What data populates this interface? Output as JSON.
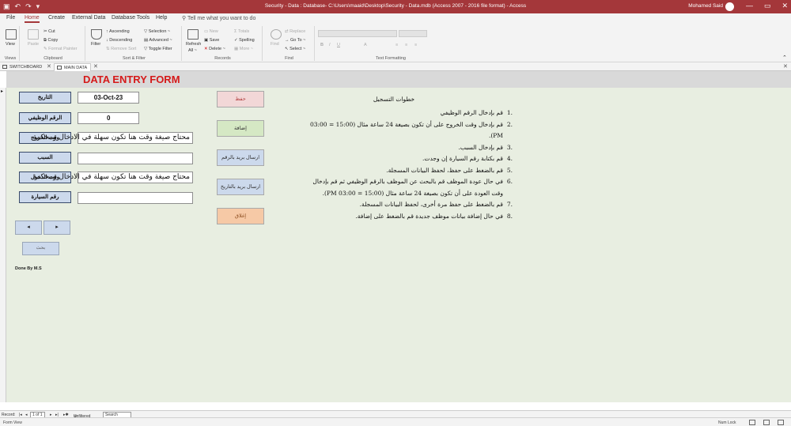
{
  "titlebar": {
    "title": "Security - Data : Database- C:\\Users\\maaid\\Desktop\\Security - Data.mdb (Access 2007 - 2016 file format) - Access",
    "user": "Mohamed Said",
    "minimize": "—",
    "restore": "▭",
    "close": "✕"
  },
  "menu": {
    "file": "File",
    "home": "Home",
    "create": "Create",
    "external": "External Data",
    "dbtools": "Database Tools",
    "help": "Help",
    "tellme": "Tell me what you want to do"
  },
  "ribbon": {
    "views": {
      "view": "View",
      "label": "Views"
    },
    "clipboard": {
      "paste": "Paste",
      "cut": "Cut",
      "copy": "Copy",
      "format_painter": "Format Painter",
      "label": "Clipboard"
    },
    "sortfilter": {
      "filter": "Filter",
      "ascending": "Ascending",
      "descending": "Descending",
      "remove_sort": "Remove Sort",
      "selection": "Selection ~",
      "advanced": "Advanced ~",
      "toggle_filter": "Toggle Filter",
      "label": "Sort & Filter"
    },
    "records": {
      "refresh": "Refresh",
      "all": "All ~",
      "new": "New",
      "save": "Save",
      "delete": "Delete ~",
      "totals": "Totals",
      "spelling": "Spelling",
      "more": "More ~",
      "label": "Records"
    },
    "find": {
      "find": "Find",
      "replace": "Replace",
      "goto": "Go To ~",
      "select": "Select ~",
      "label": "Find"
    },
    "text_formatting": {
      "label": "Text Formatting"
    }
  },
  "object_tabs": {
    "switchboard": "SWITCHBOARD",
    "main_data": "MAIN DATA"
  },
  "form": {
    "title": "DATA ENTRY FORM",
    "fields": {
      "date_label": "التاريخ",
      "date_value": "03-Oct-23",
      "id_label": "الرقم الوظيفي",
      "id_value": "0",
      "exit_label": "وقت الخروج",
      "exit_value": "محتاج صيغة وقت هنا تكون سهلة في الادخال ومحكمة",
      "reason_label": "السبب",
      "reason_value": "",
      "entry_label": "وقت الدخول",
      "entry_value": "محتاج صيغة وقت هنا تكون سهلة في الادخال ومحكمة",
      "car_label": "رقم السيارة",
      "car_value": ""
    },
    "buttons": {
      "save": "حفظ",
      "add": "إضافة",
      "mail_by_id": "ارسال بريد بالرقم",
      "mail_by_date": "ارسال بريد بالتاريخ",
      "close": "إغلاق",
      "prev": "◂",
      "next": "▸",
      "search": "بحث"
    },
    "done_by": "Done By M.S",
    "instructions": {
      "title": "خطوات التسجيل",
      "steps": [
        {
          "num": "1.",
          "text": "قم بإدخال الرقم الوظيفي"
        },
        {
          "num": "2.",
          "text": "قم بإدخال وقت الخروج على أن تكون بصيغة 24 ساعة مثال (15:00 = 03:00 PM)."
        },
        {
          "num": "3.",
          "text": "قم بإدخال السبب."
        },
        {
          "num": "4.",
          "text": "قم بكتابة رقم السيارة إن وجدت."
        },
        {
          "num": "5.",
          "text": "قم بالضغط على حفظ، لحفظ البيانات المسجلة."
        },
        {
          "num": "6.",
          "text": "في حال عودة الموظف قم بالبحث عن الموظف بالرقم الوظيفي ثم قم بإدخال وقت العودة على أن تكون بصيغة 24 ساعة مثال (15:00 = 03:00 PM)."
        },
        {
          "num": "7.",
          "text": "قم بالضغط على حفظ مرة أخرى، لحفظ البيانات المسجلة."
        },
        {
          "num": "8.",
          "text": "في حال إضافة بيانات موظف جديدة قم بالضغط على إضافة."
        }
      ]
    }
  },
  "record_nav": {
    "record_label": "Record:",
    "position": "1 of 1",
    "filter": "Unfiltered",
    "search": "Search"
  },
  "status": {
    "view": "Form View",
    "numlock": "Num Lock"
  },
  "colors": {
    "accent": "#a4373a",
    "form_bg": "#e8eee1",
    "label_bg": "#ccd9ec",
    "save_btn": "#f2d7d7",
    "add_btn": "#d5e8c4",
    "mail_btn": "#ccd9ec",
    "close_btn": "#f6c9a6",
    "title_red": "#d51a1a"
  }
}
